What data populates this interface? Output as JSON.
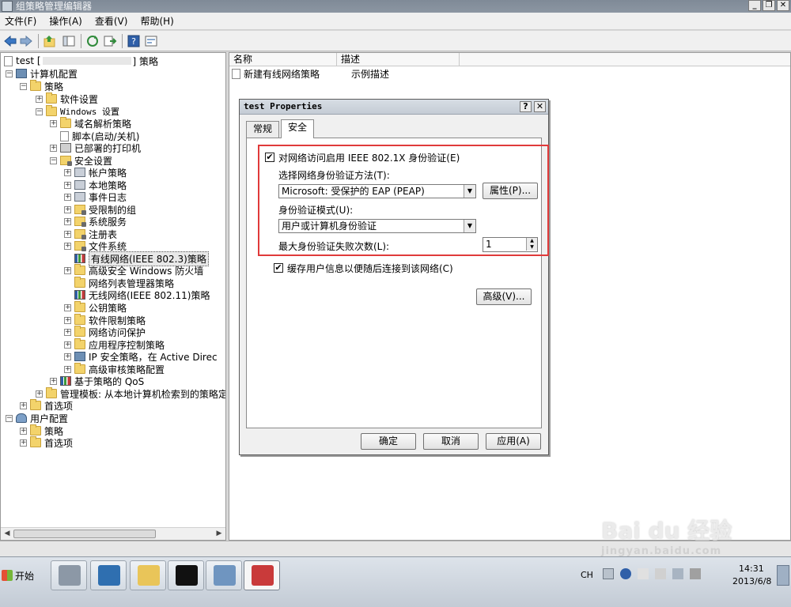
{
  "window": {
    "title": "组策略管理编辑器"
  },
  "menu": [
    "文件(F)",
    "操作(A)",
    "查看(V)",
    "帮助(H)"
  ],
  "tree": {
    "root": "test [",
    "root_suffix": "] 策略",
    "computer_config": "计算机配置",
    "policies": "策略",
    "software_settings": "软件设置",
    "windows_settings": "Windows 设置",
    "name_resolution": "域名解析策略",
    "scripts": "脚本(启动/关机)",
    "deployed_printers": "已部署的打印机",
    "security_settings": "安全设置",
    "account_policies": "帐户策略",
    "local_policies": "本地策略",
    "event_log": "事件日志",
    "restricted_groups": "受限制的组",
    "system_services": "系统服务",
    "registry": "注册表",
    "file_system": "文件系统",
    "wired_network": "有线网络(IEEE 802.3)策略",
    "advanced_firewall": "高级安全 Windows 防火墙",
    "network_list": "网络列表管理器策略",
    "wireless_network": "无线网络(IEEE 802.11)策略",
    "public_key": "公钥策略",
    "software_restriction": "软件限制策略",
    "nap": "网络访问保护",
    "applocker": "应用程序控制策略",
    "ipsec": "IP 安全策略，在 Active Direc",
    "audit": "高级审核策略配置",
    "qos": "基于策略的 QoS",
    "admin_templates": "管理模板: 从本地计算机检索到的策略定",
    "preferences": "首选项",
    "user_config": "用户配置",
    "user_policies": "策略",
    "user_preferences": "首选项"
  },
  "list": {
    "columns": [
      "名称",
      "描述"
    ],
    "rows": [
      {
        "name": "新建有线网络策略",
        "desc": "示例描述"
      }
    ]
  },
  "dialog": {
    "title": "test Properties",
    "help_btn": "?",
    "close_btn": "✕",
    "tabs": [
      "常规",
      "安全"
    ],
    "active_tab": "安全",
    "enable_8021x": "对网络访问启用 IEEE 802.1X 身份验证(E)",
    "enable_8021x_checked": true,
    "auth_method_label": "选择网络身份验证方法(T):",
    "auth_method_value": "Microsoft: 受保护的 EAP (PEAP)",
    "properties_btn": "属性(P)...",
    "auth_mode_label": "身份验证模式(U):",
    "auth_mode_value": "用户或计算机身份验证",
    "max_failures_label": "最大身份验证失败次数(L):",
    "max_failures_value": "1",
    "cache_user_info": "缓存用户信息以便随后连接到该网络(C)",
    "cache_user_info_checked": true,
    "advanced_btn": "高级(V)...",
    "ok_btn": "确定",
    "cancel_btn": "取消",
    "apply_btn": "应用(A)"
  },
  "taskbar": {
    "start_label": "开始",
    "lang": "CH",
    "time": "14:31",
    "date": "2013/6/8"
  },
  "watermark": {
    "brand": "Bai du 经验",
    "url": "jingyan.baidu.com"
  },
  "icons": [
    "back-icon",
    "forward-icon",
    "up-icon",
    "show-hide-tree-icon",
    "refresh-icon",
    "export-icon",
    "help-icon",
    "properties-icon"
  ],
  "colors": {
    "highlight_box": "#e03a3a",
    "taskbar": "#c3cbd5"
  }
}
